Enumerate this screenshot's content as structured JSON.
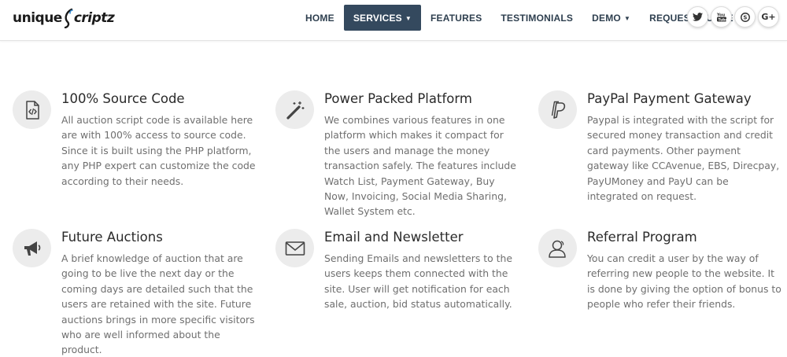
{
  "brand": {
    "logo_part1": "unique",
    "logo_part2": "criptz"
  },
  "nav": [
    {
      "label": "HOME",
      "dropdown": false,
      "active": false
    },
    {
      "label": "SERVICES",
      "dropdown": true,
      "active": true
    },
    {
      "label": "FEATURES",
      "dropdown": false,
      "active": false
    },
    {
      "label": "TESTIMONIALS",
      "dropdown": false,
      "active": false
    },
    {
      "label": "DEMO",
      "dropdown": true,
      "active": false
    },
    {
      "label": "REQUEST QUOTE",
      "dropdown": false,
      "active": false
    }
  ],
  "social": [
    {
      "icon": "twitter-icon"
    },
    {
      "icon": "youtube-icon"
    },
    {
      "icon": "skype-icon"
    },
    {
      "icon": "google-plus-icon",
      "text": "G+"
    }
  ],
  "colors": {
    "nav_active_bg": "#34495e",
    "nav_text": "#2e3f4f",
    "icon_circle": "#ececec"
  },
  "features": [
    {
      "icon": "code-file-icon",
      "title": "100% Source Code",
      "body": "All auction script code is available here are with 100% access to source code. Since it is built using the PHP platform, any PHP expert can customize the code according to their needs."
    },
    {
      "icon": "magic-wand-icon",
      "title": "Power Packed Platform",
      "body": "We combines various features in one platform which makes it compact for the users and manage the money transaction safely. The features include Watch List, Payment Gateway, Buy Now, Invoicing, Social Media Sharing, Wallet System etc."
    },
    {
      "icon": "paypal-icon",
      "title": "PayPal Payment Gateway",
      "body": "Paypal is integrated with the script for secured money transaction and credit card payments. Other payment gateway like CCAvenue, EBS, Direcpay, PayUMoney and PayU can be integrated on request."
    },
    {
      "icon": "megaphone-icon",
      "title": "Future Auctions",
      "body": "A brief knowledge of auction that are going to be live the next day or the coming days are detailed such that the users are retained with the site. Future auctions brings in more specific visitors who are well informed about the product."
    },
    {
      "icon": "envelope-icon",
      "title": "Email and Newsletter",
      "body": "Sending Emails and newsletters to the users keeps them connected with the site. User will get notification for each sale, auction, bid status automatically."
    },
    {
      "icon": "user-referral-icon",
      "title": "Referral Program",
      "body": "You can credit a user by the way of referring new people to the website. It is done by giving the option of bonus to people who refer their friends."
    }
  ]
}
